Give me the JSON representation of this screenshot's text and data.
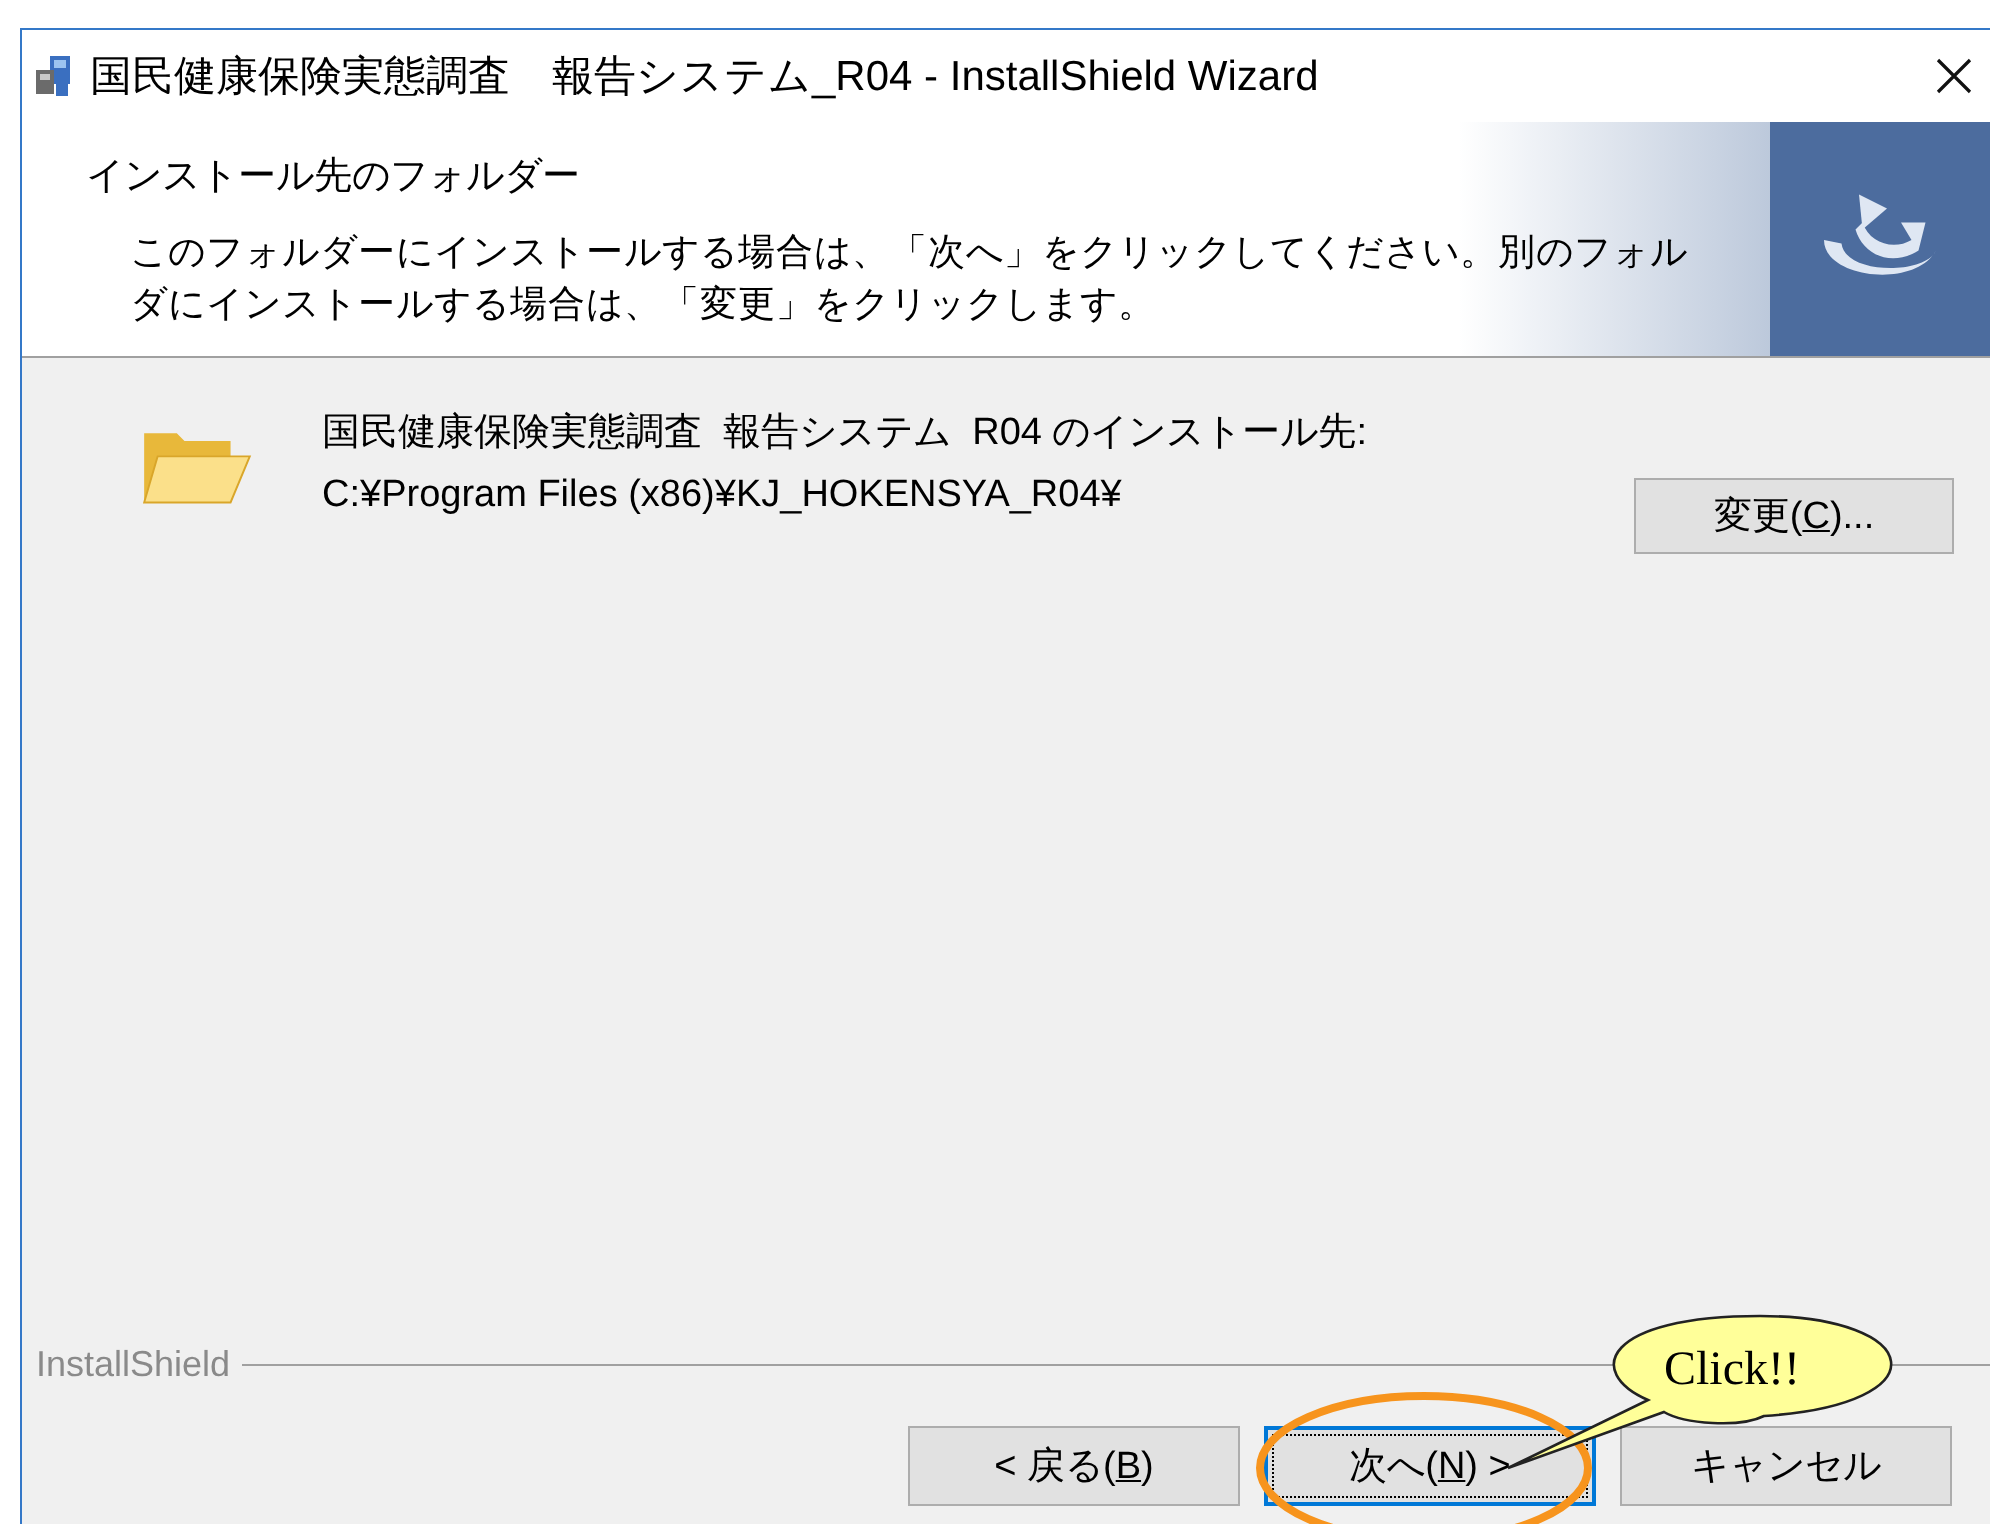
{
  "window": {
    "title": "国民健康保険実態調査　報告システム_R04 - InstallShield Wizard"
  },
  "header": {
    "title": "インストール先のフォルダー",
    "description": "このフォルダーにインストールする場合は、「次へ」をクリックしてください。別のフォルダにインストールする場合は、「変更」をクリックします。"
  },
  "destination": {
    "label": "国民健康保険実態調査  報告システム  R04 のインストール先:",
    "path": "C:¥Program Files (x86)¥KJ_HOKENSYA_R04¥",
    "change_button": {
      "before": "変更(",
      "key": "C",
      "after": ")..."
    }
  },
  "footer": {
    "brand": "InstallShield"
  },
  "buttons": [
    {
      "before": "< 戻る(",
      "key": "B",
      "after": ")",
      "focused": false
    },
    {
      "before": "次へ(",
      "key": "N",
      "after": ") >",
      "focused": true
    },
    {
      "before": "キャンセル",
      "focused": false
    }
  ],
  "callout": {
    "text": "Click!!"
  }
}
